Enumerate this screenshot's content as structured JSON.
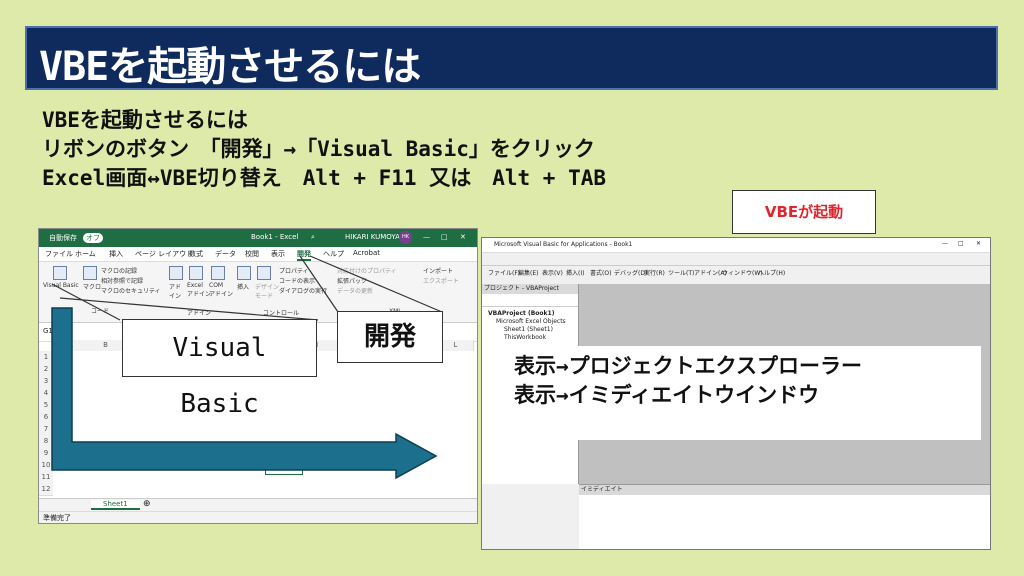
{
  "slide": {
    "title": "VBEを起動させるには",
    "lines": [
      "VBEを起動させるには",
      "リボンのボタン　「開発」→「Visual Basic」をクリック",
      "Excel画面↔VBE切り替え　Alt + F11 又は　Alt + TAB"
    ],
    "badge": "VBEが起動"
  },
  "excel": {
    "autosave": "自動保存",
    "autosave_state": "オフ",
    "file_title": "Book1 - Excel",
    "user": "HIKARI KUMOYAMA",
    "user_initials": "HK",
    "tabs": [
      "ファイル",
      "ホーム",
      "挿入",
      "ページ レイアウト",
      "数式",
      "データ",
      "校閲",
      "表示",
      "開発",
      "ヘルプ",
      "Acrobat"
    ],
    "ribbon": {
      "visual_basic": "Visual Basic",
      "macro": "マクロ",
      "record_macro": "マクロの記録",
      "relative_ref": "相対参照で記録",
      "macro_security": "マクロのセキュリティ",
      "addins": "アド\nイン",
      "excel_addins": "Excel\nアドイン",
      "com_addins": "COM\nアドイン",
      "insert": "挿入",
      "design_mode": "デザイン\nモード",
      "properties": "プロパティ",
      "view_code": "コードの表示",
      "run_dialog": "ダイアログの実行",
      "map_props": "対応付けのプロパティ",
      "expansion_pack": "拡張パック",
      "refresh_data": "データの更新",
      "import": "インポート",
      "export": "エクスポート",
      "group_code": "コード",
      "group_addin": "アドイン",
      "group_controls": "コントロール",
      "group_xml": "XML"
    },
    "name_box": "G1",
    "columns": [
      "A",
      "B",
      "C",
      "D",
      "E",
      "F",
      "G",
      "H",
      "I",
      "J",
      "K",
      "L"
    ],
    "rows": [
      "1",
      "2",
      "3",
      "4",
      "5",
      "6",
      "7",
      "8",
      "9",
      "10",
      "11",
      "12"
    ],
    "sheet_tab": "Sheet1",
    "status": "準備完了"
  },
  "vbe": {
    "title": "Microsoft Visual Basic for Applications - Book1",
    "menu": [
      "ファイル(F)",
      "編集(E)",
      "表示(V)",
      "挿入(I)",
      "書式(O)",
      "デバッグ(D)",
      "実行(R)",
      "ツール(T)",
      "アドイン(A)",
      "ウィンドウ(W)",
      "ヘルプ(H)"
    ],
    "project_title": "プロジェクト - VBAProject",
    "tree": [
      "VBAProject (Book1)",
      "Microsoft Excel Objects",
      "Sheet1 (Sheet1)",
      "ThisWorkbook"
    ],
    "immediate_title": "イミディエイト"
  },
  "callouts": {
    "visual_basic": "Visual　Basic",
    "developer": "開発",
    "menu_lines": [
      "表示→プロジェクトエクスプローラー",
      "表示→イミディエイトウインドウ"
    ]
  },
  "colors": {
    "background": "#ddeaa9",
    "title_bg": "#0f2a5c",
    "excel_green": "#1f6e43",
    "arrow": "#1d6f8e",
    "badge_text": "#e0262d"
  }
}
